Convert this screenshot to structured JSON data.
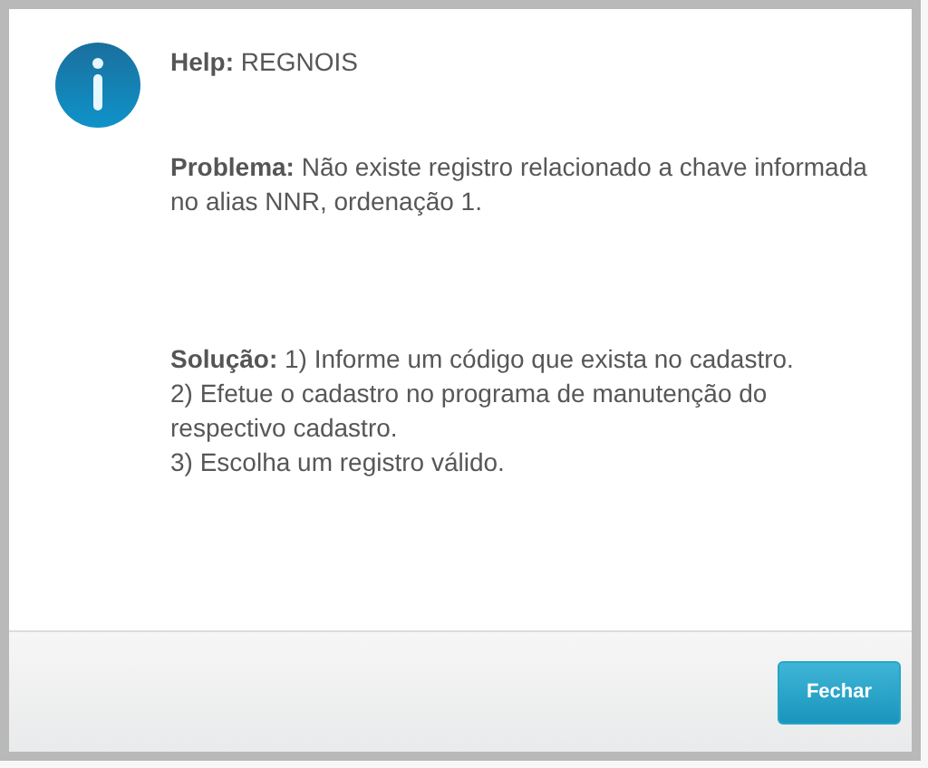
{
  "dialog": {
    "help": "**Help:** REGNOIS",
    "problem": "**Problema:** Não existe registro relacionado a chave informada no alias NNR, ordenação 1.",
    "solution": "**Solução:** 1) Informe um código que exista no cadastro.\n2) Efetue o cadastro no programa de manutenção do respectivo cadastro.\n3) Escolha um registro válido.",
    "buttons": [
      "Fechar"
    ]
  }
}
